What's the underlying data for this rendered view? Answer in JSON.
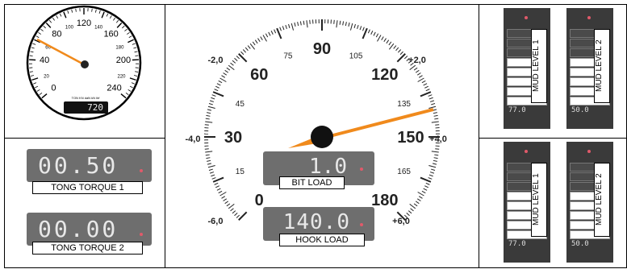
{
  "small_gauge": {
    "ticks": [
      "0",
      "20",
      "40",
      "60",
      "80",
      "100",
      "120",
      "140",
      "160",
      "180",
      "200",
      "220",
      "240"
    ],
    "unit_text": "TON KN daN kN lbf",
    "readout": "720"
  },
  "tong_torque": [
    {
      "value": "00.50",
      "label": "TONG TORQUE 1"
    },
    {
      "value": "00.00",
      "label": "TONG TORQUE 2"
    }
  ],
  "main_gauge": {
    "major_labels": [
      "0",
      "15",
      "30",
      "45",
      "60",
      "75",
      "90",
      "105",
      "120",
      "135",
      "150",
      "165",
      "180"
    ],
    "scale_marks": [
      "-2,0",
      "+2,0",
      "-4,0",
      "+4,0",
      "-6,0",
      "+6,0"
    ],
    "bit_load": {
      "value": "1.0",
      "label": "BIT LOAD"
    },
    "hook_load": {
      "value": "140.0",
      "label": "HOOK LOAD"
    }
  },
  "mud_panels": [
    {
      "columns": [
        {
          "label": "MUD LEVEL 1",
          "value": "77.0"
        },
        {
          "label": "MUD LEVEL 2",
          "value": "50.0"
        }
      ]
    },
    {
      "columns": [
        {
          "label": "MUD LEVEL 1",
          "value": "77.0"
        },
        {
          "label": "MUD LEVEL 2",
          "value": "50.0"
        }
      ]
    }
  ],
  "colors": {
    "needle": "#f08a1c",
    "display_bg": "#6e6e6e",
    "panel_dark": "#3a3a3a",
    "indicator": "#e05a6a"
  }
}
